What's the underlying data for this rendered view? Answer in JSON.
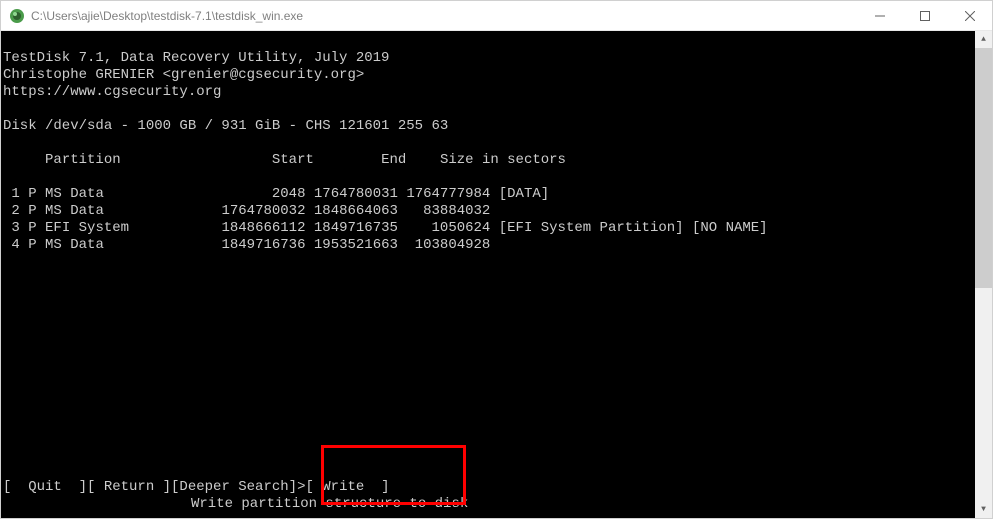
{
  "window": {
    "title": "C:\\Users\\ajie\\Desktop\\testdisk-7.1\\testdisk_win.exe"
  },
  "header": {
    "line1": "TestDisk 7.1, Data Recovery Utility, July 2019",
    "line2": "Christophe GRENIER <grenier@cgsecurity.org>",
    "line3": "https://www.cgsecurity.org"
  },
  "disk_line": "Disk /dev/sda - 1000 GB / 931 GiB - CHS 121601 255 63",
  "columns": {
    "partition": "Partition",
    "start": "Start",
    "end": "End",
    "size": "Size in sectors"
  },
  "partitions": [
    {
      "num": "1",
      "flag": "P",
      "type": "MS Data",
      "start": "      2048",
      "end": "1764780031",
      "size": "1764777984",
      "label": "[DATA]"
    },
    {
      "num": "2",
      "flag": "P",
      "type": "MS Data",
      "start": "1764780032",
      "end": "1848664063",
      "size": "  83884032",
      "label": ""
    },
    {
      "num": "3",
      "flag": "P",
      "type": "EFI System",
      "start": "1848666112",
      "end": "1849716735",
      "size": "   1050624",
      "label": "[EFI System Partition] [NO NAME]"
    },
    {
      "num": "4",
      "flag": "P",
      "type": "MS Data",
      "start": "1849716736",
      "end": "1953521663",
      "size": " 103804928",
      "label": ""
    }
  ],
  "menu": {
    "quit": "[  Quit  ]",
    "return": "[ Return ]",
    "deeper_search": "[Deeper Search]",
    "write": ">[ Write  ]"
  },
  "hint": "Write partition structure to disk"
}
